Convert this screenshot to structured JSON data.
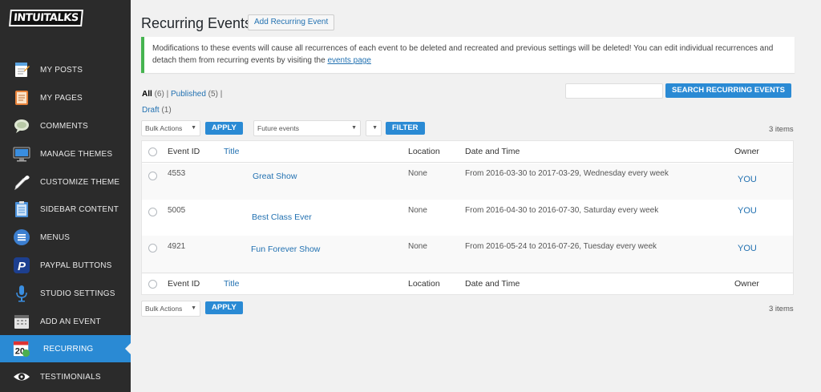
{
  "sidebar": {
    "logo": "INTUITALKS",
    "items": [
      {
        "label": "MY POSTS",
        "icon": "notepad-icon"
      },
      {
        "label": "MY PAGES",
        "icon": "pages-icon"
      },
      {
        "label": "COMMENTS",
        "icon": "speech-bubble-icon"
      },
      {
        "label": "MANAGE THEMES",
        "icon": "monitor-icon"
      },
      {
        "label": "CUSTOMIZE THEME",
        "icon": "eyedropper-icon"
      },
      {
        "label": "SIDEBAR CONTENT",
        "icon": "clipboard-icon"
      },
      {
        "label": "MENUS",
        "icon": "menu-icon"
      },
      {
        "label": "PAYPAL BUTTONS",
        "icon": "paypal-icon"
      },
      {
        "label": "STUDIO SETTINGS",
        "icon": "microphone-icon"
      },
      {
        "label": "ADD AN EVENT",
        "icon": "calendar-icon"
      },
      {
        "label": "RECURRING",
        "icon": "recurring-calendar-icon"
      },
      {
        "label": "TESTIMONIALS",
        "icon": "eye-icon"
      }
    ],
    "active_index": 10
  },
  "page": {
    "title": "Recurring Events",
    "add_button": "Add Recurring Event"
  },
  "notice": {
    "text": "Modifications to these events will cause all recurrences of each event to be deleted and recreated and previous settings will be deleted! You can edit individual recurrences and detach them from recurring events by visiting the ",
    "link": "events page"
  },
  "filters": {
    "all_label": "All",
    "all_count": "(6)",
    "published_label": "Published",
    "published_count": "(5)",
    "draft_label": "Draft",
    "draft_count": "(1)",
    "sep": "|"
  },
  "search": {
    "placeholder": "",
    "button": "Search Recurring Events"
  },
  "toolbar_top": {
    "bulk_actions": "Bulk Actions",
    "apply": "Apply",
    "scope": "Future events",
    "filter": "Filter",
    "count": "3 items"
  },
  "table": {
    "columns": {
      "event_id": "Event ID",
      "title": "Title",
      "location": "Location",
      "date_time": "Date and Time",
      "owner": "Owner"
    },
    "rows": [
      {
        "event_id": "4553",
        "title": "Great Show",
        "location": "None",
        "date_time": "From 2016-03-30 to 2017-03-29, Wednesday every week",
        "owner": "YOU"
      },
      {
        "event_id": "5005",
        "title": "Best Class Ever",
        "location": "None",
        "date_time": "From 2016-04-30 to 2016-07-30, Saturday every week",
        "owner": "YOU"
      },
      {
        "event_id": "4921",
        "title": "Fun Forever Show",
        "location": "None",
        "date_time": "From 2016-05-24 to 2016-07-26, Tuesday every week",
        "owner": "YOU"
      }
    ]
  },
  "toolbar_bottom": {
    "bulk_actions": "Bulk Actions",
    "apply": "Apply",
    "count": "3 items"
  },
  "colors": {
    "sidebar_bg": "#2b2b2b",
    "accent": "#2a8ad4",
    "notice_border": "#46b450",
    "link": "#2271b1"
  }
}
